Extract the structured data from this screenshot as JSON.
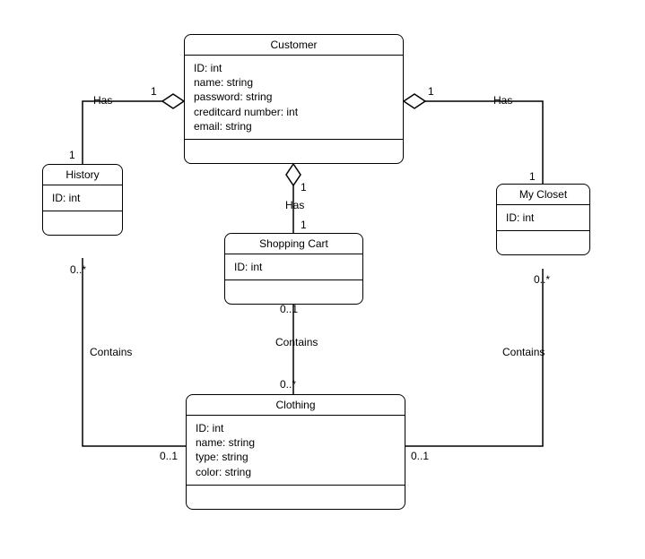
{
  "classes": {
    "customer": {
      "title": "Customer",
      "attrs": [
        "ID: int",
        "name: string",
        "password: string",
        "creditcard number: int",
        "email: string"
      ]
    },
    "history": {
      "title": "History",
      "attrs": [
        "ID: int"
      ]
    },
    "mycloset": {
      "title": "My Closet",
      "attrs": [
        "ID: int"
      ]
    },
    "shoppingcart": {
      "title": "Shopping Cart",
      "attrs": [
        "ID: int"
      ]
    },
    "clothing": {
      "title": "Clothing",
      "attrs": [
        "ID: int",
        "name: string",
        "type: string",
        "color: string"
      ]
    }
  },
  "relations": {
    "cust_history": {
      "label": "Has",
      "near_cust": "1",
      "near_history": "1"
    },
    "cust_mycloset": {
      "label": "Has",
      "near_cust": "1",
      "near_mycloset": "1"
    },
    "cust_cart": {
      "label": "Has",
      "near_cust": "1",
      "near_cart": "1"
    },
    "history_clothing": {
      "label": "Contains",
      "near_history": "0..*",
      "near_clothing": "0..1"
    },
    "mycloset_clothing": {
      "label": "Contains",
      "near_mycloset": "0..*",
      "near_clothing": "0..1"
    },
    "cart_clothing": {
      "label": "Contains",
      "near_cart": "0..1",
      "near_clothing": "0..*"
    }
  }
}
